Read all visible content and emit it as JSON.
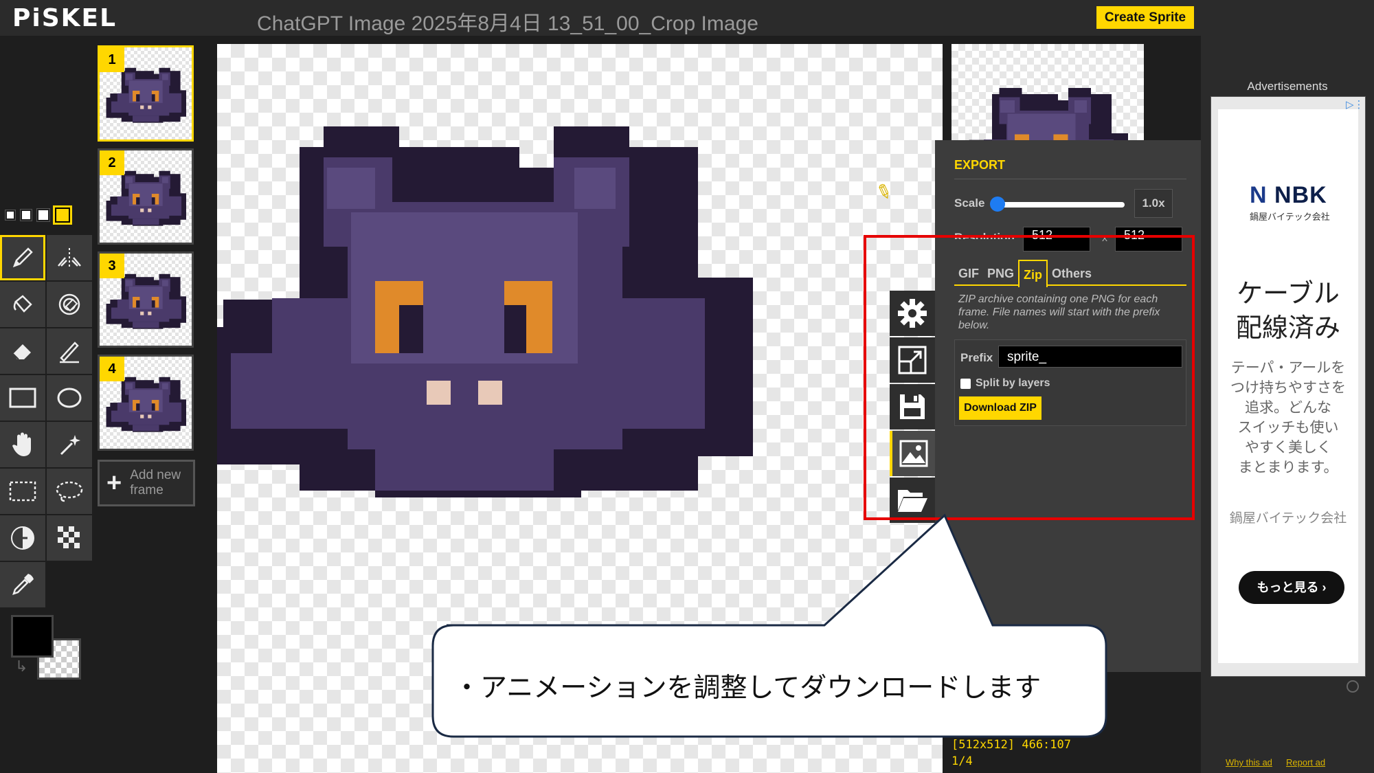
{
  "header": {
    "logo": "PiSKEL",
    "title": "ChatGPT Image 2025年8月4日 13_51_00_Crop Image",
    "create_sprite": "Create Sprite"
  },
  "tools": {
    "pen_sizes": [
      "1",
      "2",
      "3",
      "4"
    ],
    "items": [
      "pen-tool",
      "vertical-mirror-pen",
      "paint-bucket",
      "paint-all-same-color",
      "eraser",
      "stroke",
      "rectangle",
      "circle",
      "move",
      "shape-selection",
      "rectangle-selection",
      "lasso-selection",
      "lighten",
      "dithering",
      "color-picker"
    ],
    "primary_color": "#000000"
  },
  "frames": {
    "items": [
      {
        "number": "1"
      },
      {
        "number": "2"
      },
      {
        "number": "3"
      },
      {
        "number": "4"
      }
    ],
    "add_new": "Add new frame"
  },
  "export": {
    "title": "EXPORT",
    "scale_label": "Scale",
    "scale_value": "1.0x",
    "resolution_label": "Resolution",
    "width": "512",
    "x_sep": "x",
    "height": "512",
    "tabs": [
      "GIF",
      "PNG",
      "Zip",
      "Others"
    ],
    "active_tab": "Zip",
    "zip_description": "ZIP archive containing one PNG for each frame. File names will start with the prefix below.",
    "prefix_label": "Prefix",
    "prefix_value": "sprite_",
    "split_label": "Split by layers",
    "download": "Download ZIP"
  },
  "side_tabs": [
    "settings-icon",
    "resize-icon",
    "save-icon",
    "export-image-icon",
    "open-folder-icon"
  ],
  "callout": {
    "text": "・アニメーションを調整してダウンロードします"
  },
  "status": {
    "coords": "[512x512] 466:107",
    "frame": "1/4"
  },
  "ad": {
    "header": "Advertisements",
    "brand": "NBK",
    "brand_sub": "鍋屋バイテック会社",
    "headline_1": "ケーブル",
    "headline_2": "配線済み",
    "body": [
      "テーパ・アールを",
      "つけ持ちやすさを",
      "追求。どんな",
      "スイッチも使い",
      "やすく美しく",
      "まとまります。"
    ],
    "company": "鍋屋バイテック会社",
    "more": "もっと見る ›",
    "why": "Why this ad",
    "report": "Report ad"
  },
  "colors": {
    "accent": "#ffd700",
    "highlight": "#e60000",
    "bat_dark": "#241a34",
    "bat_mid": "#4a3a6a",
    "bat_light": "#5a4a7e",
    "eye": "#e08a2a",
    "tooth": "#e8c9b8"
  }
}
